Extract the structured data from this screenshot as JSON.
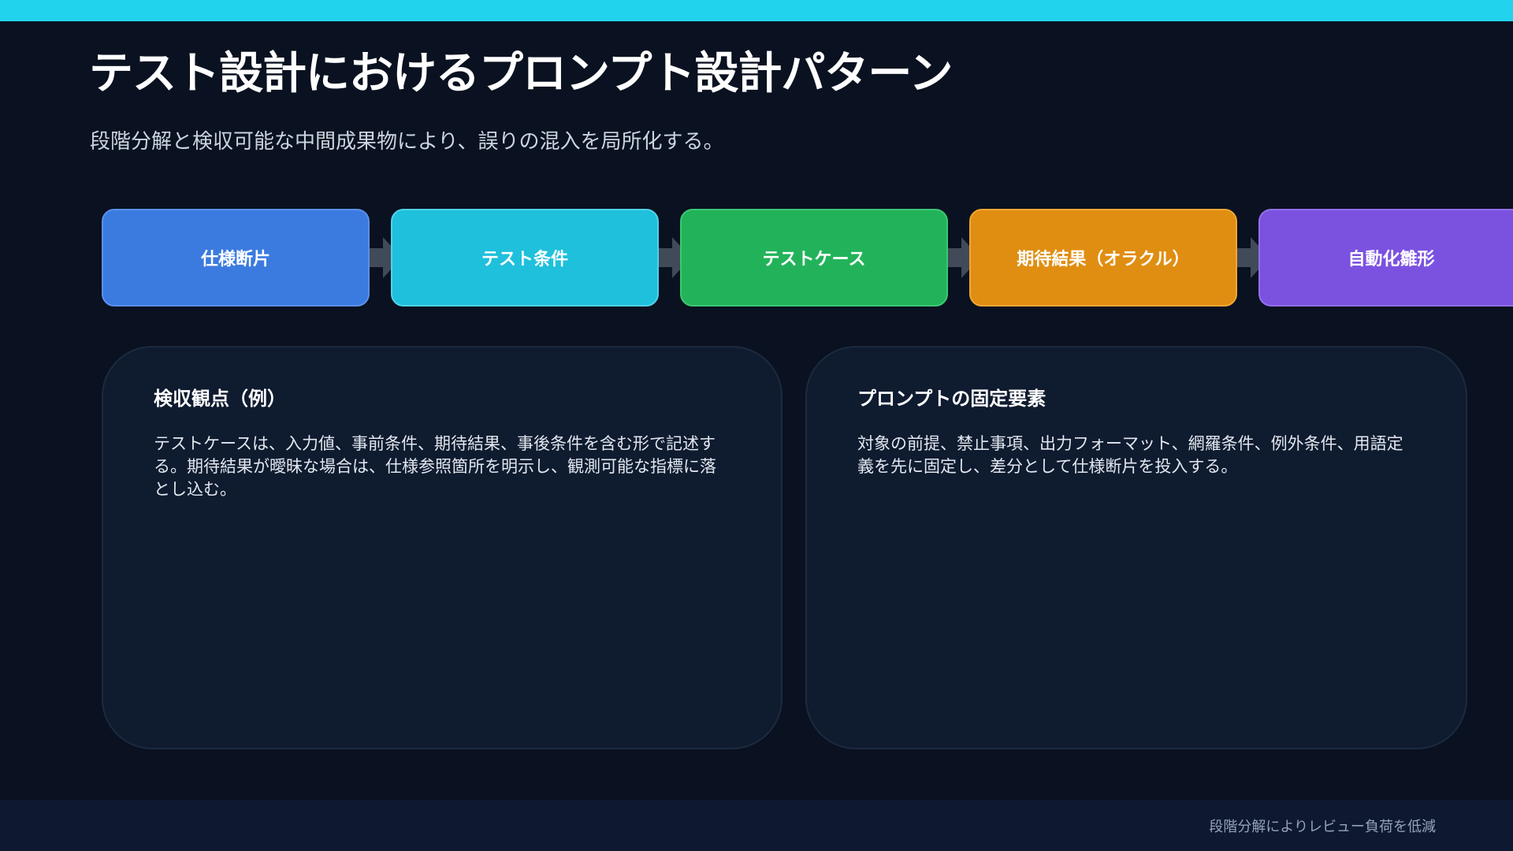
{
  "slide": {
    "title": "テスト設計におけるプロンプト設計パターン",
    "subtitle": "段階分解と検収可能な中間成果物により、誤りの混入を局所化する。"
  },
  "flow": {
    "steps": [
      {
        "label": "仕様断片",
        "color": "#3b7be0"
      },
      {
        "label": "テスト条件",
        "color": "#1fc0dc"
      },
      {
        "label": "テストケース",
        "color": "#22b35a"
      },
      {
        "label": "期待結果（オラクル）",
        "color": "#e08e12"
      },
      {
        "label": "自動化雛形",
        "color": "#7b52e0"
      }
    ],
    "arrow_icon": "arrow-right-icon",
    "arrow_color": "#4b5563"
  },
  "cards": [
    {
      "title": "検収観点（例）",
      "body": "テストケースは、入力値、事前条件、期待結果、事後条件を含む形で記述する。期待結果が曖昧な場合は、仕様参照箇所を明示し、観測可能な指標に落とし込む。"
    },
    {
      "title": "プロンプトの固定要素",
      "body": "対象の前提、禁止事項、出力フォーマット、網羅条件、例外条件、用語定義を先に固定し、差分として仕様断片を投入する。"
    }
  ],
  "footer": {
    "note": "段階分解によりレビュー負荷を低減"
  },
  "colors": {
    "accent_bar": "#22d3ee",
    "background": "#0a1120",
    "card_background": "#0f1b2f",
    "footer_background": "#0e1830"
  }
}
